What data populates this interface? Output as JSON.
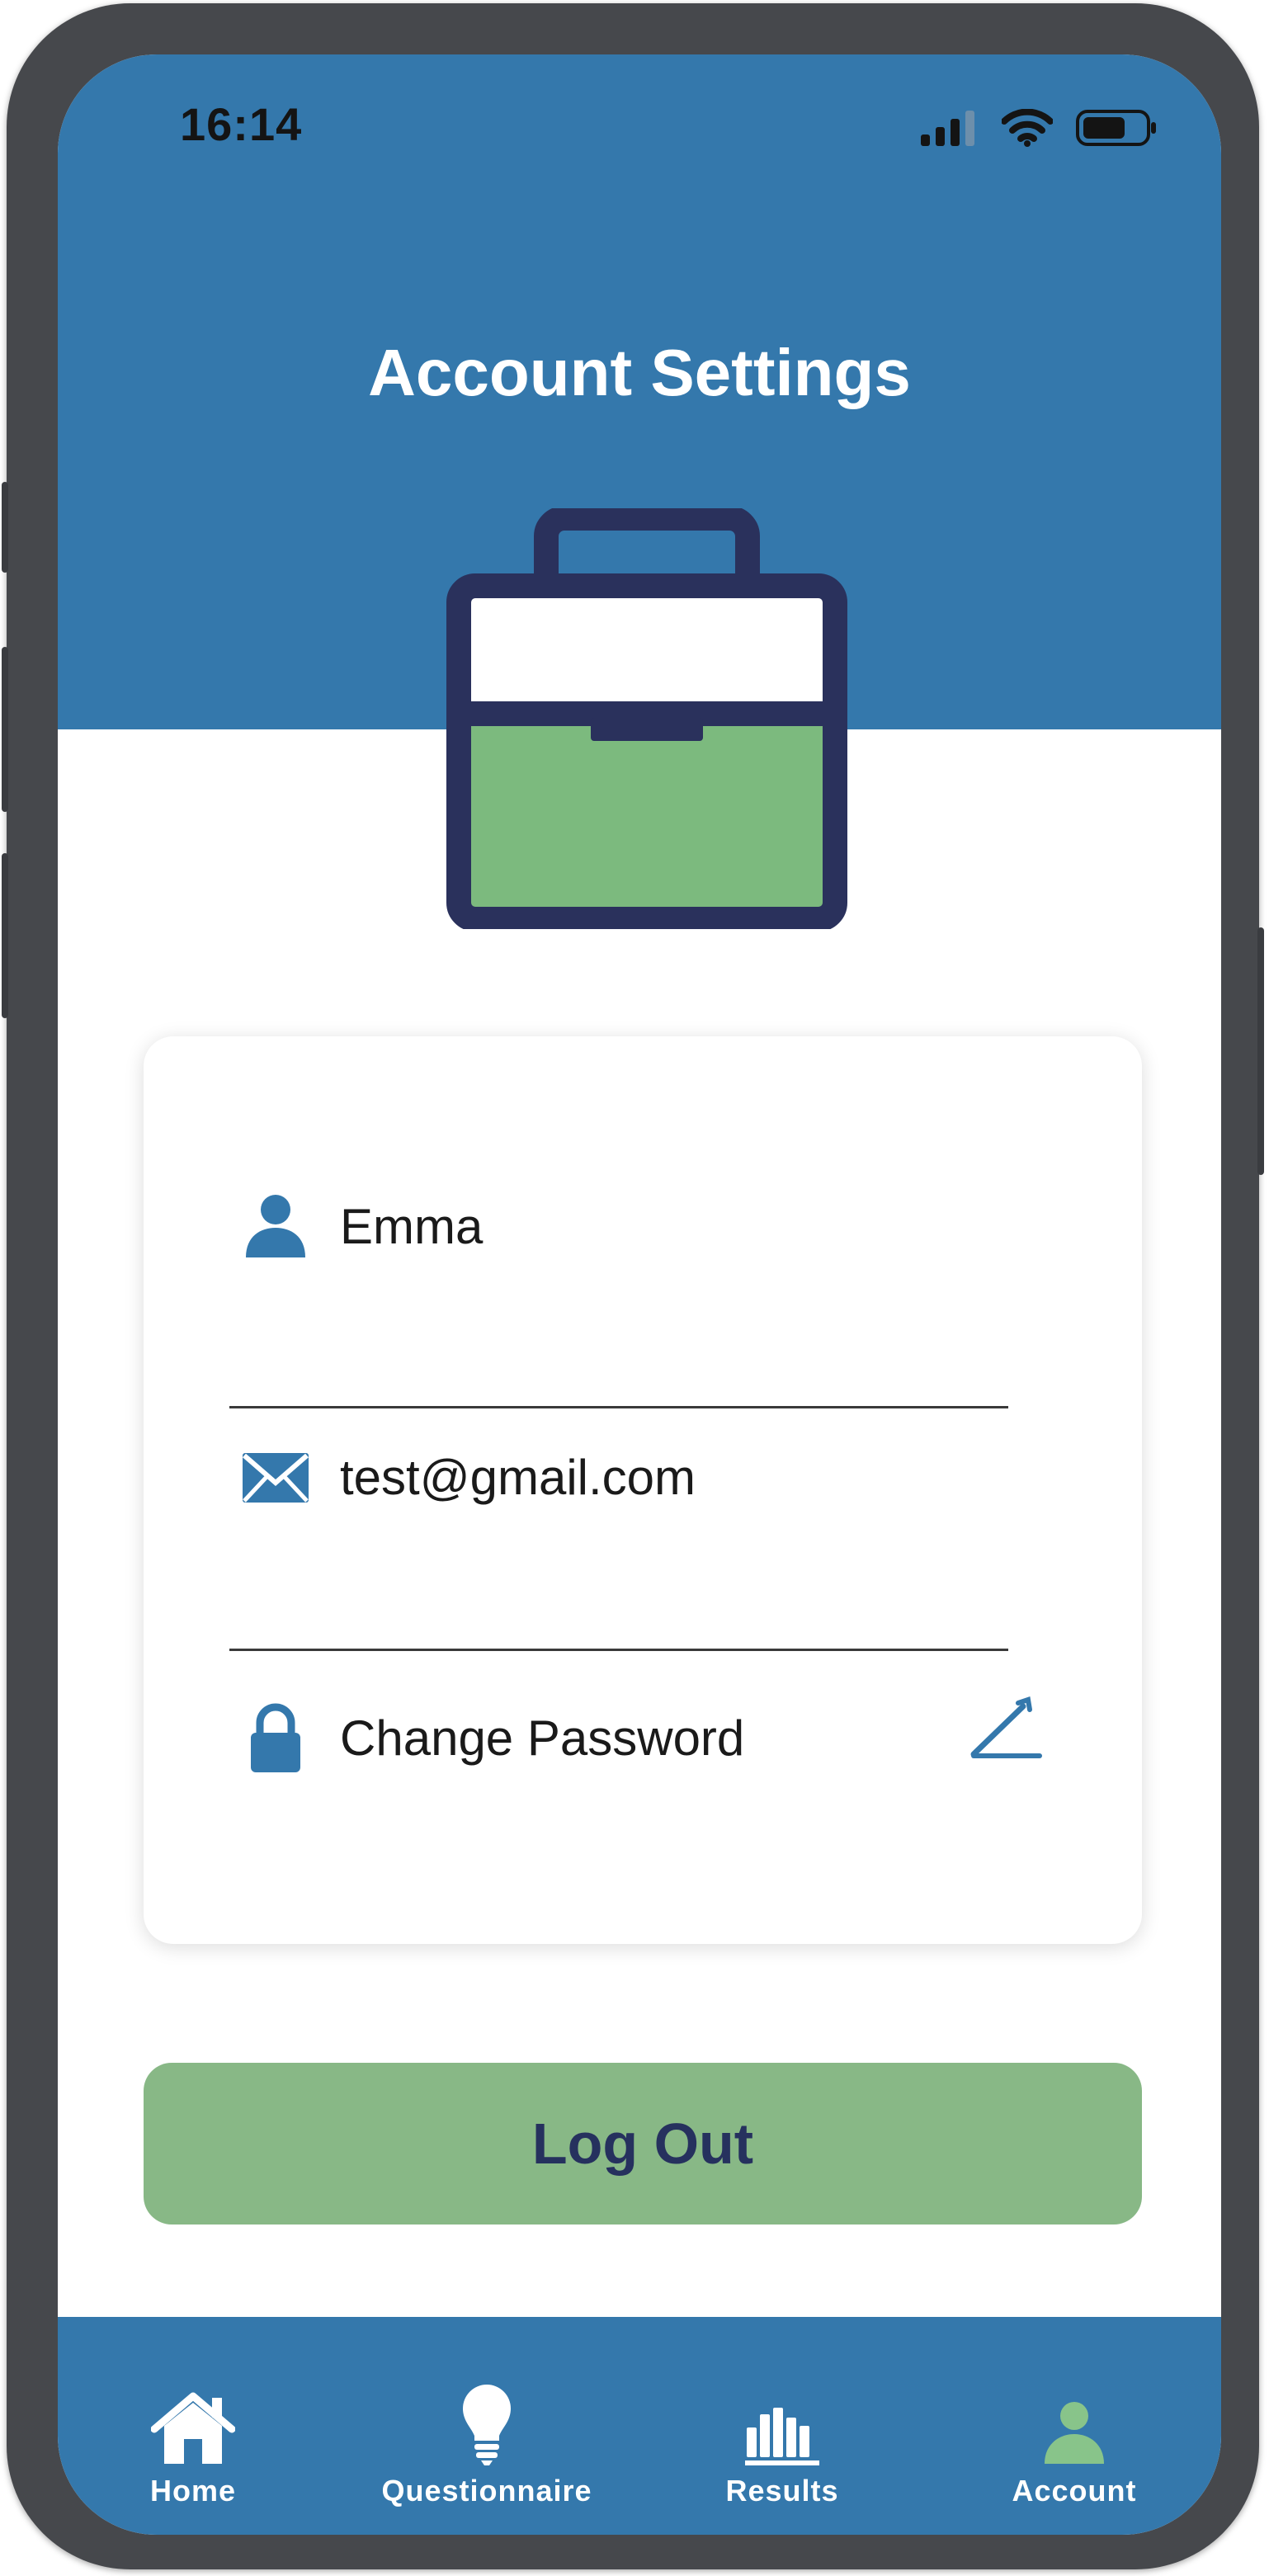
{
  "status_bar": {
    "time": "16:14",
    "icons": [
      "cellular-signal-icon",
      "wifi-icon",
      "battery-icon"
    ]
  },
  "header": {
    "title": "Account Settings",
    "illustration": "briefcase-icon"
  },
  "account_card": {
    "name": {
      "icon": "user-icon",
      "value": "Emma"
    },
    "email": {
      "icon": "envelope-icon",
      "value": "test@gmail.com"
    },
    "password": {
      "icon": "lock-icon",
      "label": "Change Password",
      "action_icon": "pencil-edit-icon"
    }
  },
  "logout_label": "Log Out",
  "tab_bar": {
    "tabs": [
      {
        "label": "Home",
        "icon": "home-icon"
      },
      {
        "label": "Questionnaire",
        "icon": "lightbulb-icon"
      },
      {
        "label": "Results",
        "icon": "bar-chart-icon"
      },
      {
        "label": "Account",
        "icon": "user-icon",
        "active": true
      }
    ]
  },
  "colors": {
    "primary_blue": "#3478ac",
    "accent_green": "#88b886",
    "navy": "#26315e",
    "active_tab_icon": "#88c48a"
  }
}
